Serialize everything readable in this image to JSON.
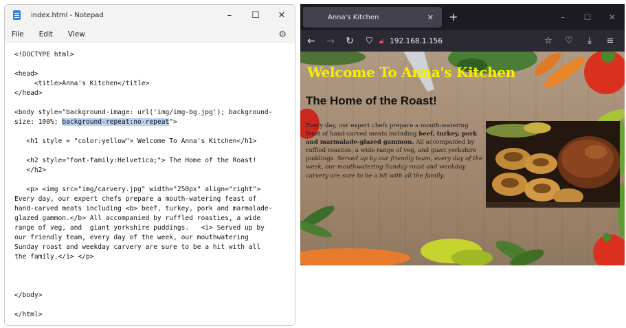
{
  "notepad": {
    "title": "index.html - Notepad",
    "window_buttons": {
      "minimize": "–",
      "maximize": "☐",
      "close": "✕"
    },
    "menu": [
      "File",
      "Edit",
      "View"
    ],
    "lines": [
      "<!DOCTYPE html>",
      "",
      "<head>",
      "     <title>Anna's Kitchen</title>",
      "</head>",
      "",
      "<body style=\"background-image: url('img/img-bg.jpg'); background-",
      "size: 100%; ",
      "",
      "   <h1 style = \"color:yellow\"> Welcome To Anna's Kitchen</h1>",
      "",
      "   <h2 style=\"font-family:Helvetica;\"> The Home of the Roast!",
      "   </h2>",
      "",
      "   <p> <img src=\"img/carvery.jpg\" width=\"250px\" align=\"right\">",
      "Every day, our expert chefs prepare a mouth-watering feast of",
      "hand-carved meats including <b> beef, turkey, pork and marmalade-",
      "glazed gammon.</b> All accompanied by ruffled roasties, a wide",
      "range of veg, and  giant yorkshire puddings.   <i> Served up by",
      "our friendly team, every day of the week, our mouthwatering",
      "Sunday roast and weekday carvery are sure to be a hit with all",
      "the family.</i> </p>",
      "",
      "",
      "",
      "</body>",
      "",
      "</html>"
    ],
    "selected_text": "background-repeat:no-repeat",
    "line7_suffix": "\">"
  },
  "browser": {
    "tab_title": "Anna's Kitchen",
    "tab_close": "✕",
    "new_tab": "+",
    "window_buttons": {
      "minimize": "–",
      "maximize": "☐",
      "close": "✕"
    },
    "url": "192.168.1.156",
    "page": {
      "h1": "Welcome To Anna's Kitchen",
      "h2": "The Home of the Roast!",
      "para_plain": "Every day, our expert chefs prepare a mouth-watering feast of hand-carved meats including ",
      "para_bold": "beef, turkey, pork and marmalade-glazed gammon.",
      "para_mid": " All accompanied by ruffled roasties, a wide range of veg, and giant yorkshire puddings. ",
      "para_italic": "Served up by our friendly team, every day of the week, our mouthwatering Sunday roast and weekday carvery are sure to be a hit with all the family."
    }
  },
  "colors": {
    "h1_yellow": "#f5f000",
    "selection": "#b7d3f0",
    "firefox_toolbar": "#2b2a33",
    "firefox_tabbar": "#1c1b22"
  }
}
